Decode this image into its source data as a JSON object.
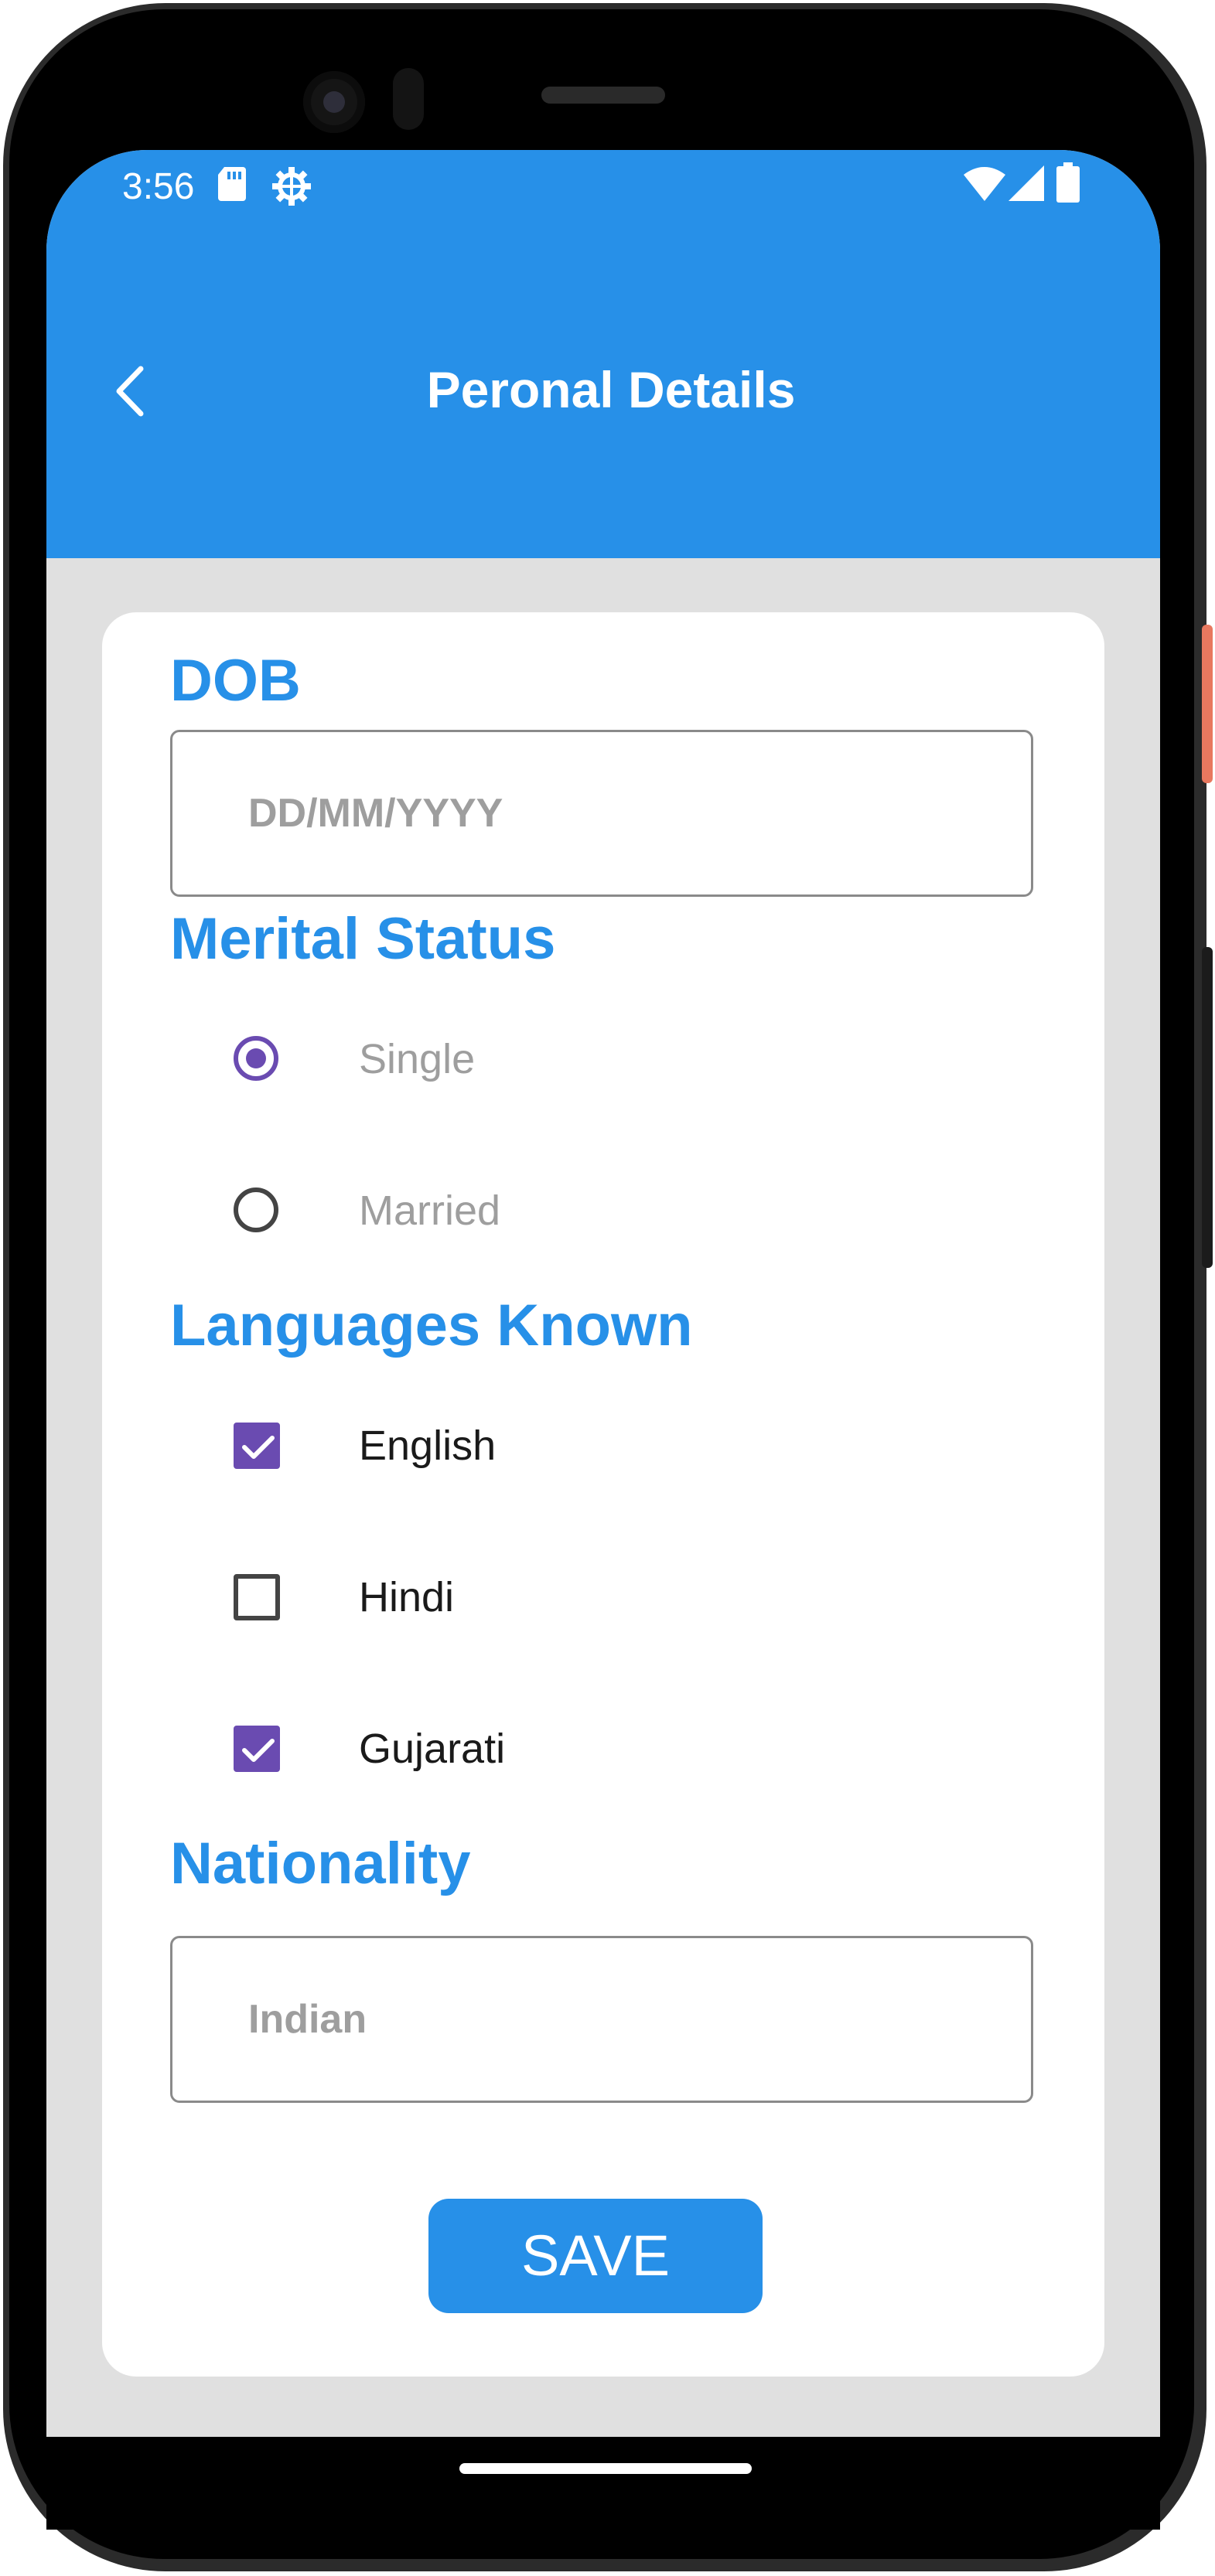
{
  "status_bar": {
    "time": "3:56",
    "icons": [
      "sd-card-icon",
      "settings-gear-icon",
      "wifi-icon",
      "cell-signal-icon",
      "battery-icon"
    ]
  },
  "app_bar": {
    "back_icon": "chevron-left-icon",
    "title": "Peronal Details"
  },
  "form": {
    "dob": {
      "label": "DOB",
      "placeholder": "DD/MM/YYYY"
    },
    "marital_status": {
      "label": "Merital Status",
      "options": [
        {
          "label": "Single",
          "selected": true
        },
        {
          "label": "Married",
          "selected": false
        }
      ]
    },
    "languages": {
      "label": "Languages Known",
      "options": [
        {
          "label": "English",
          "checked": true
        },
        {
          "label": "Hindi",
          "checked": false
        },
        {
          "label": "Gujarati",
          "checked": true
        }
      ]
    },
    "nationality": {
      "label": "Nationality",
      "value": "Indian"
    },
    "save_label": "SAVE"
  },
  "colors": {
    "primary": "#2790e8",
    "accent": "#6a4bb1",
    "background": "#e0e0e0",
    "card": "#ffffff",
    "hint_text": "#9e9e9e"
  }
}
